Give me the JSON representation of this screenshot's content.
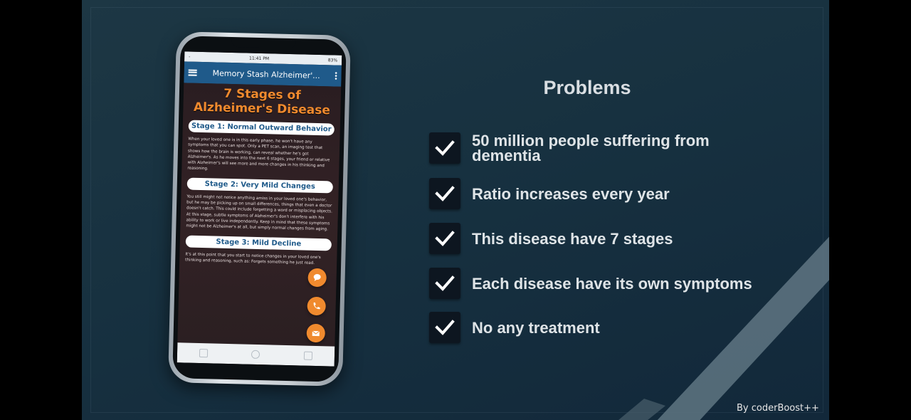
{
  "phone": {
    "status_left": "-",
    "status_time": "11:41 PM",
    "status_right": "83%",
    "app_title": "Memory Stash Alzheimer'...",
    "article_title": "7 Stages of Alzheimer's Disease",
    "stages": [
      {
        "label": "Stage 1: Normal Outward Behavior",
        "text": "When your loved one is in this early phase, he won't have any symptoms that you can spot. Only a PET scan, an imaging test that shows how the brain is working, can reveal whether he's got Alzheimer's. As he moves into the next 6 stages, your friend or relative with Alzheimer's will see more and more changes in his thinking and reasoning."
      },
      {
        "label": "Stage 2: Very Mild Changes",
        "text": "You still might not notice anything amiss in your loved one's behavior, but he may be picking up on small differences, things that even a doctor doesn't catch. This could include forgetting a word or misplacing objects. At this stage, subtle symptoms of Alzheimer's don't interfere with his ability to work or live independently. Keep in mind that these symptoms might not be Alzheimer's at all, but simply normal changes from aging."
      },
      {
        "label": "Stage 3: Mild Decline",
        "text": "It's at this point that you start to notice changes in your loved one's thinking and reasoning, such as: Forgets something he just read."
      }
    ],
    "fab_icons": [
      "chat-icon",
      "phone-icon",
      "mail-icon"
    ]
  },
  "problems": {
    "title": "Problems",
    "items": [
      "50 million people suffering from dementia",
      "Ratio increases every year",
      "This disease have 7 stages",
      "Each disease have its own symptoms",
      "No any treatment"
    ]
  },
  "credit": "By coderBoost++",
  "colors": {
    "accent_orange": "#f08a2e",
    "appbar_blue": "#1f5a8a",
    "slide_bg": "#173140",
    "text_light": "#dfe4e7"
  }
}
